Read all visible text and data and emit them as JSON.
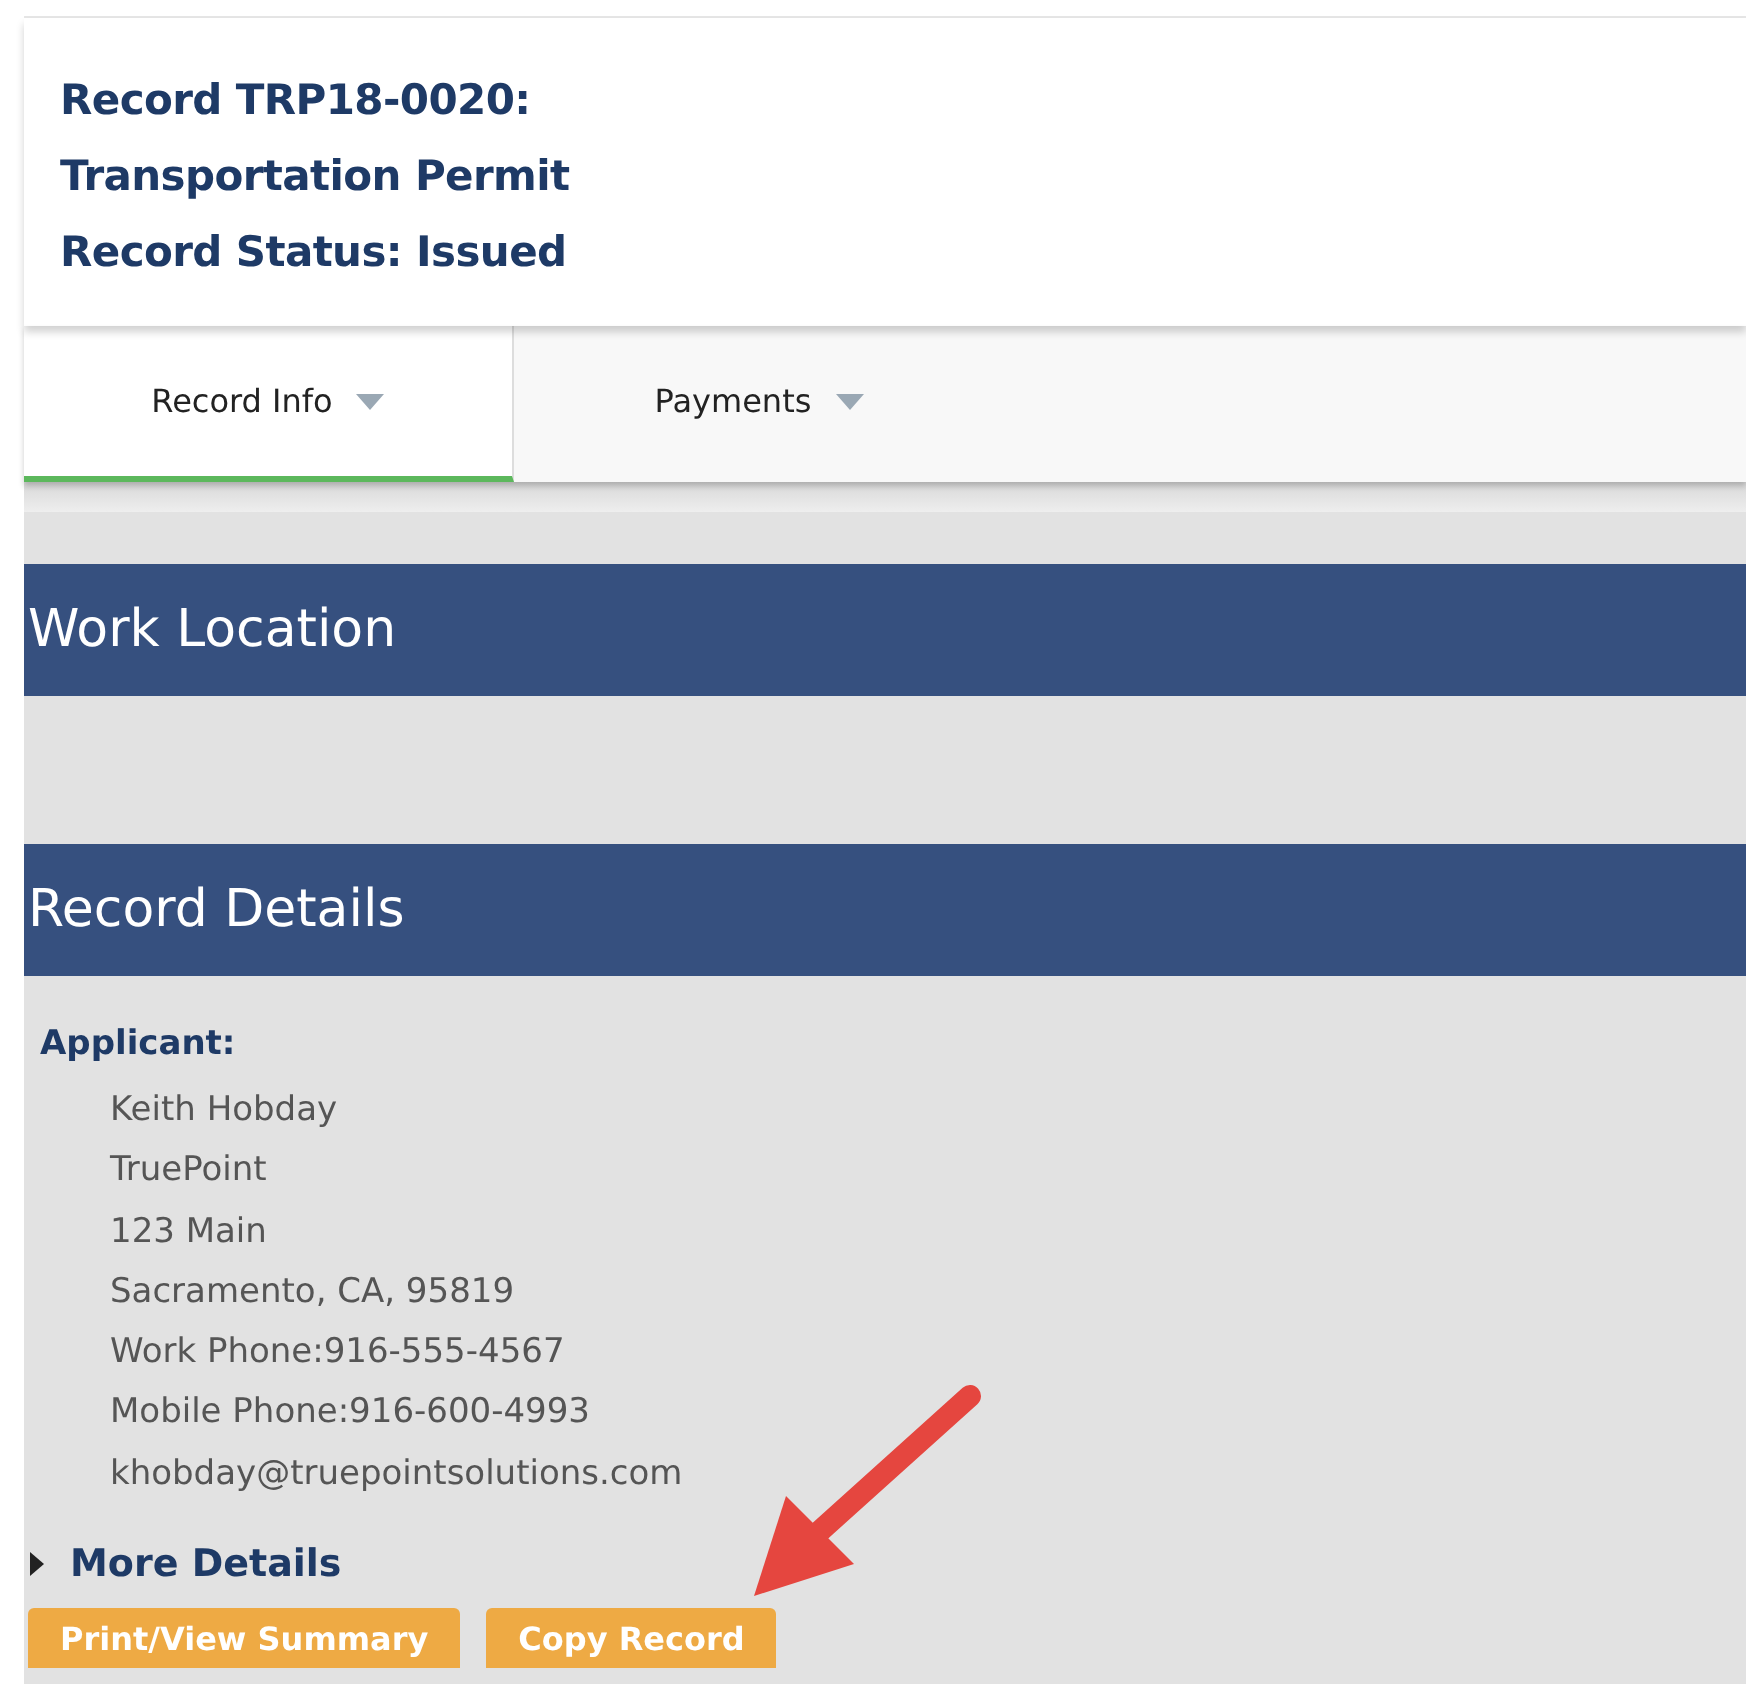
{
  "header": {
    "lines": [
      "Record TRP18-0020:",
      "Transportation Permit",
      "Record Status: Issued"
    ]
  },
  "tabs": [
    {
      "label": "Record Info",
      "selected": true
    },
    {
      "label": "Payments",
      "selected": false
    }
  ],
  "sections": [
    {
      "title": "Work Location"
    },
    {
      "title": "Record Details"
    }
  ],
  "applicant": {
    "label": "Applicant:",
    "lines": [
      "Keith Hobday",
      "TruePoint",
      "123 Main",
      "Sacramento, CA, 95819",
      "Work Phone:916-555-4567",
      "Mobile Phone:916-600-4993",
      "khobday@truepointsolutions.com"
    ]
  },
  "more_details": {
    "label": "More Details",
    "expanded": false
  },
  "buttons": [
    "Print/View Summary",
    "Copy Record"
  ]
}
